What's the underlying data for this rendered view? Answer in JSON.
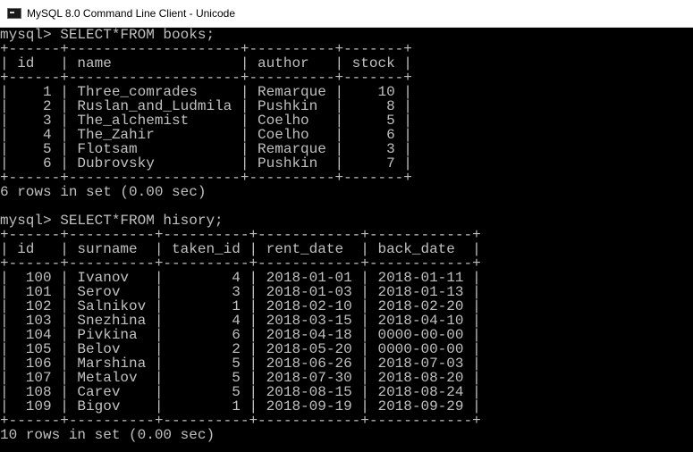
{
  "window": {
    "title": "MySQL 8.0 Command Line Client - Unicode",
    "icon": "console-icon"
  },
  "console": {
    "lines": [
      "mysql> SELECT*FROM books;",
      "+------+--------------------+----------+-------+",
      "| id   | name               | author   | stock |",
      "+------+--------------------+----------+-------+",
      "|    1 | Three_comrades     | Remarque |    10 |",
      "|    2 | Ruslan_and_Ludmila | Pushkin  |     8 |",
      "|    3 | The_alchemist      | Coelho   |     5 |",
      "|    4 | The_Zahir          | Coelho   |     6 |",
      "|    5 | Flotsam            | Remarque |     3 |",
      "|    6 | Dubrovsky          | Pushkin  |     7 |",
      "+------+--------------------+----------+-------+",
      "6 rows in set (0.00 sec)",
      "",
      "mysql> SELECT*FROM hisory;",
      "+------+----------+----------+------------+------------+",
      "| id   | surname  | taken_id | rent_date  | back_date  |",
      "+------+----------+----------+------------+------------+",
      "|  100 | Ivanov   |        4 | 2018-01-01 | 2018-01-11 |",
      "|  101 | Serov    |        3 | 2018-01-03 | 2018-01-13 |",
      "|  102 | Salnikov |        1 | 2018-02-10 | 2018-02-20 |",
      "|  103 | Snezhina |        4 | 2018-03-15 | 2018-04-10 |",
      "|  104 | Pivkina  |        6 | 2018-04-18 | 0000-00-00 |",
      "|  105 | Belov    |        2 | 2018-05-20 | 0000-00-00 |",
      "|  106 | Marshina |        5 | 2018-06-26 | 2018-07-03 |",
      "|  107 | Metalov  |        5 | 2018-07-30 | 2018-08-20 |",
      "|  108 | Carev    |        5 | 2018-08-15 | 2018-08-24 |",
      "|  109 | Bigov    |        1 | 2018-09-19 | 2018-09-29 |",
      "+------+----------+----------+------------+------------+",
      "10 rows in set (0.00 sec)"
    ]
  }
}
